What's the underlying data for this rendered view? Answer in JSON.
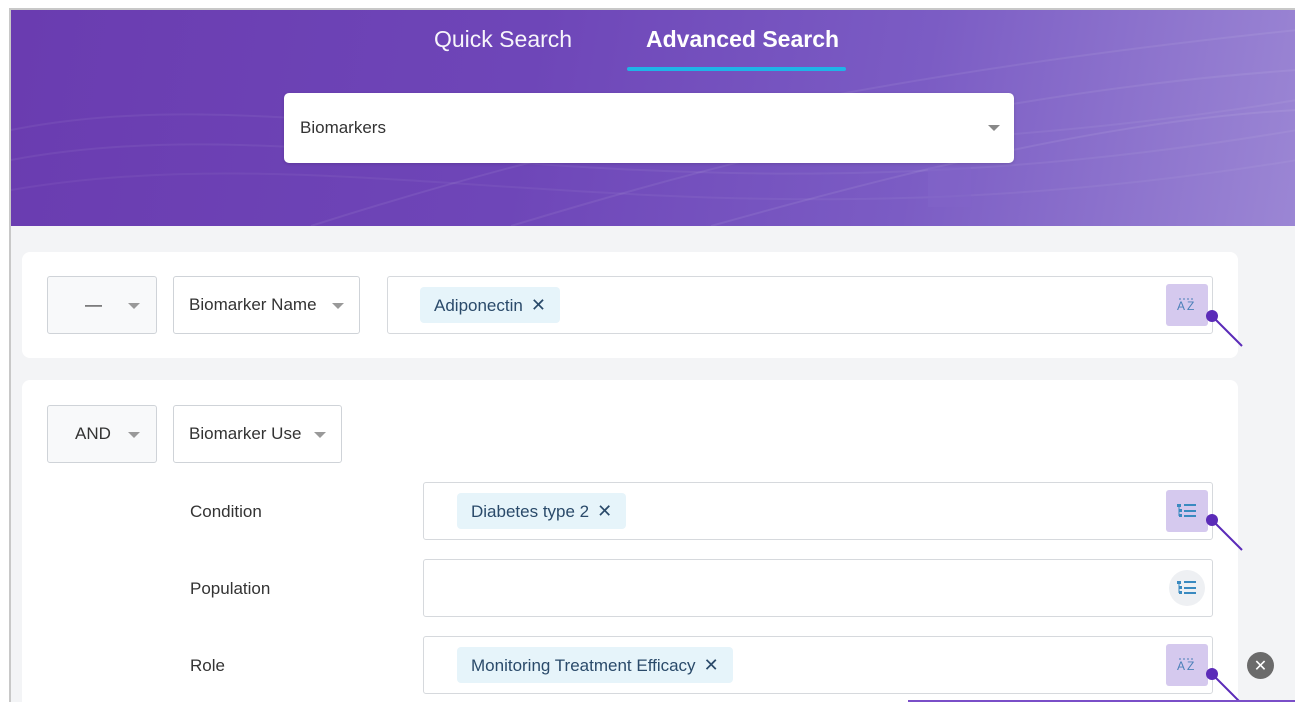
{
  "tabs": {
    "quick_search": "Quick Search",
    "advanced_search": "Advanced Search",
    "active": "advanced_search"
  },
  "search_type": {
    "value": "Biomarkers"
  },
  "criteria": [
    {
      "operator": "—",
      "field": "Biomarker Name",
      "chips": [
        "Adiponectin"
      ],
      "action_icon": "sort-az-icon"
    },
    {
      "operator": "AND",
      "field": "Biomarker Use",
      "sub_fields": [
        {
          "label": "Condition",
          "chips": [
            "Diabetes type 2"
          ],
          "action_icon": "list-tree-icon"
        },
        {
          "label": "Population",
          "chips": [],
          "action_icon": "list-tree-icon"
        },
        {
          "label": "Role",
          "chips": [
            "Monitoring Treatment Efficacy"
          ],
          "action_icon": "sort-az-icon"
        }
      ]
    }
  ],
  "chip_remove_symbol": "✕",
  "colors": {
    "header_gradient_start": "#6a3cb0",
    "header_gradient_end": "#9b86d4",
    "tab_underline": "#1fb4e8",
    "chip_background": "#e6f4fa",
    "highlight": "#d5c9ee",
    "pointer": "#5b2bb8"
  }
}
